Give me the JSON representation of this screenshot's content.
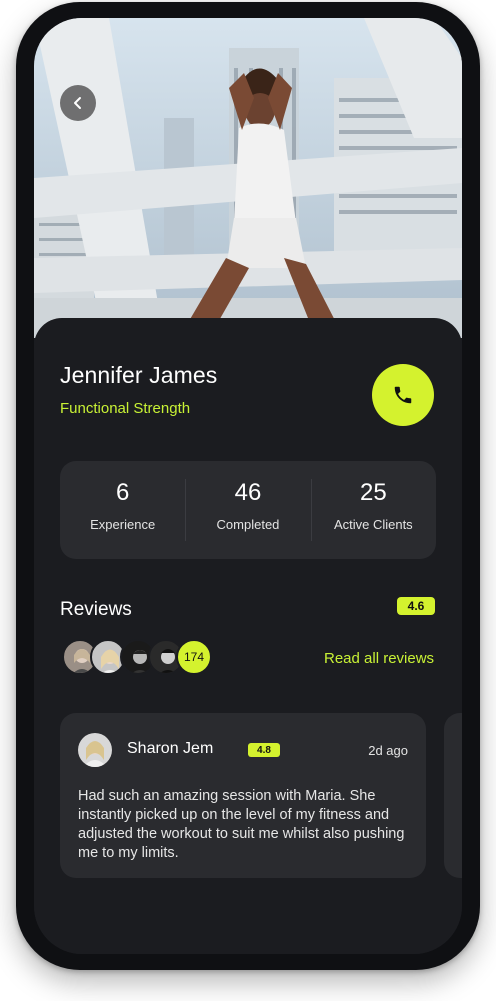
{
  "profile": {
    "name": "Jennifer James",
    "specialty": "Functional Strength"
  },
  "icons": {
    "back": "chevron-left-icon",
    "call": "phone-icon"
  },
  "stats": [
    {
      "value": "6",
      "label": "Experience"
    },
    {
      "value": "46",
      "label": "Completed"
    },
    {
      "value": "25",
      "label": "Active Clients"
    }
  ],
  "reviews": {
    "title": "Reviews",
    "rating": "4.6",
    "reviewer_count": "174",
    "read_all_label": "Read all reviews",
    "items": [
      {
        "name": "Sharon Jem",
        "rating": "4.8",
        "time": "2d ago",
        "text": "Had such an amazing session with Maria. She instantly picked up on the level of my fitness and adjusted the workout to suit me whilst also pushing me to my limits."
      }
    ]
  },
  "colors": {
    "accent": "#d4f22e",
    "background": "#1b1c20",
    "card": "#2a2b2f"
  }
}
